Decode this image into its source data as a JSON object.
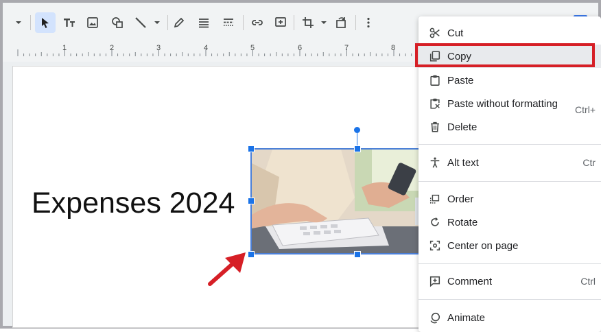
{
  "slide": {
    "title": "Expenses 2024"
  },
  "ruler": {
    "marks": [
      "1",
      "2",
      "3",
      "4",
      "5",
      "6",
      "7",
      "8"
    ]
  },
  "toolbar": {
    "icons": [
      "caret-down-icon",
      "select-icon",
      "text-box-icon",
      "image-icon",
      "shape-icon",
      "line-icon",
      "caret-down-icon",
      "pen-icon",
      "align-icon",
      "border-dash-icon",
      "link-icon",
      "add-comment-icon",
      "crop-icon",
      "caret-down-icon",
      "reset-image-icon",
      "more-icon"
    ]
  },
  "context_menu": {
    "items": [
      {
        "label": "Cut",
        "icon": "scissors-icon",
        "shortcut": ""
      },
      {
        "label": "Copy",
        "icon": "copy-icon",
        "shortcut": "",
        "highlighted": true
      },
      {
        "label": "Paste",
        "icon": "clipboard-icon",
        "shortcut": ""
      },
      {
        "label": "Paste without formatting",
        "icon": "paste-plain-icon",
        "shortcut": "Ctrl+"
      },
      {
        "label": "Delete",
        "icon": "trash-icon",
        "shortcut": ""
      },
      {
        "label": "Alt text",
        "icon": "accessibility-icon",
        "shortcut": "Ctr"
      },
      {
        "label": "Order",
        "icon": "order-icon",
        "shortcut": ""
      },
      {
        "label": "Rotate",
        "icon": "rotate-icon",
        "shortcut": ""
      },
      {
        "label": "Center on page",
        "icon": "center-icon",
        "shortcut": ""
      },
      {
        "label": "Comment",
        "icon": "comment-icon",
        "shortcut": "Ctrl"
      },
      {
        "label": "Animate",
        "icon": "animate-icon",
        "shortcut": ""
      }
    ]
  },
  "colors": {
    "selection": "#1a73e8",
    "highlight_box": "#d61f26",
    "annotation_arrow": "#d61f26"
  }
}
